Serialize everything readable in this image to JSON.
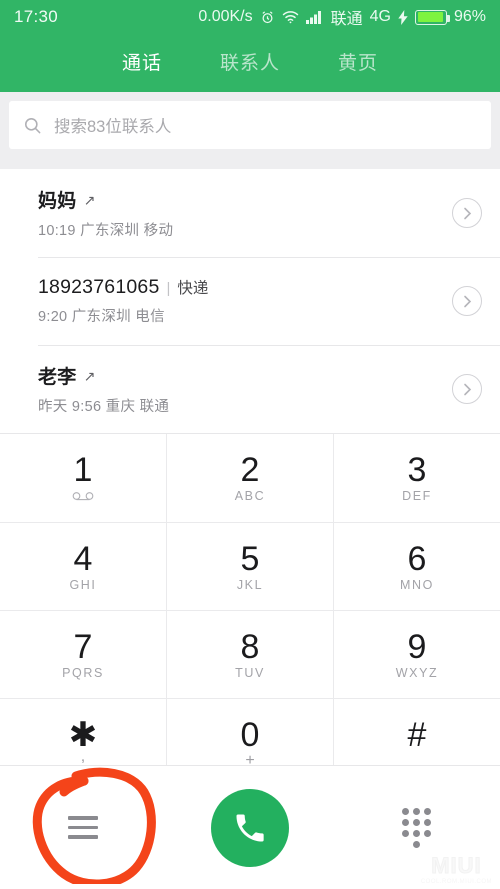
{
  "statusbar": {
    "clock": "17:30",
    "net_speed": "0.00K/s",
    "alarm_icon": "alarm-clock-icon",
    "wifi_icon": "wifi-icon",
    "signal_icon": "cellular-signal-icon",
    "carrier": "联通",
    "network_type": "4G",
    "charging_icon": "charging-bolt-icon",
    "battery_percent": "96%"
  },
  "tabs": [
    {
      "label": "通话",
      "active": true
    },
    {
      "label": "联系人",
      "active": false
    },
    {
      "label": "黄页",
      "active": false
    }
  ],
  "search": {
    "icon": "search-icon",
    "placeholder": "搜索83位联系人",
    "value": ""
  },
  "call_log": [
    {
      "name": "妈妈",
      "direction_icon": "outgoing-call-arrow-icon",
      "tag": "",
      "detail": "10:19 广东深圳 移动",
      "chevron": "chevron-right-icon"
    },
    {
      "name": "18923761065",
      "direction_icon": "",
      "tag": "快递",
      "detail": "9:20 广东深圳 电信",
      "chevron": "chevron-right-icon"
    },
    {
      "name": "老李",
      "direction_icon": "outgoing-call-arrow-icon",
      "tag": "",
      "detail": "昨天 9:56 重庆 联通",
      "chevron": "chevron-right-icon"
    }
  ],
  "dialpad": [
    [
      {
        "digit": "1",
        "sub": "",
        "sub_icon": "voicemail-icon"
      },
      {
        "digit": "2",
        "sub": "ABC",
        "sub_icon": ""
      },
      {
        "digit": "3",
        "sub": "DEF",
        "sub_icon": ""
      }
    ],
    [
      {
        "digit": "4",
        "sub": "GHI",
        "sub_icon": ""
      },
      {
        "digit": "5",
        "sub": "JKL",
        "sub_icon": ""
      },
      {
        "digit": "6",
        "sub": "MNO",
        "sub_icon": ""
      }
    ],
    [
      {
        "digit": "7",
        "sub": "PQRS",
        "sub_icon": ""
      },
      {
        "digit": "8",
        "sub": "TUV",
        "sub_icon": ""
      },
      {
        "digit": "9",
        "sub": "WXYZ",
        "sub_icon": ""
      }
    ],
    [
      {
        "digit": "✱",
        "sub": ",",
        "sub_icon": ""
      },
      {
        "digit": "0",
        "sub": "+",
        "sub_icon": ""
      },
      {
        "digit": "#",
        "sub": "",
        "sub_icon": ""
      }
    ]
  ],
  "bottom_bar": {
    "menu_icon": "hamburger-menu-icon",
    "call_icon": "phone-handset-icon",
    "keypad_icon": "dialpad-dots-icon"
  },
  "annotation": {
    "shape": "hand-drawn-circle",
    "color": "#f4441a",
    "target": "hamburger-menu-icon"
  },
  "watermark": {
    "text": "MIUI",
    "subtext": "COOL.ROM.MIUI.COM"
  },
  "colors": {
    "header_green": "#31b566",
    "call_button_green": "#23b05f",
    "battery_green": "#7ef33f",
    "annotation_red": "#f4441a",
    "page_background": "#ffffff",
    "strip_gray": "#eeeef0"
  }
}
